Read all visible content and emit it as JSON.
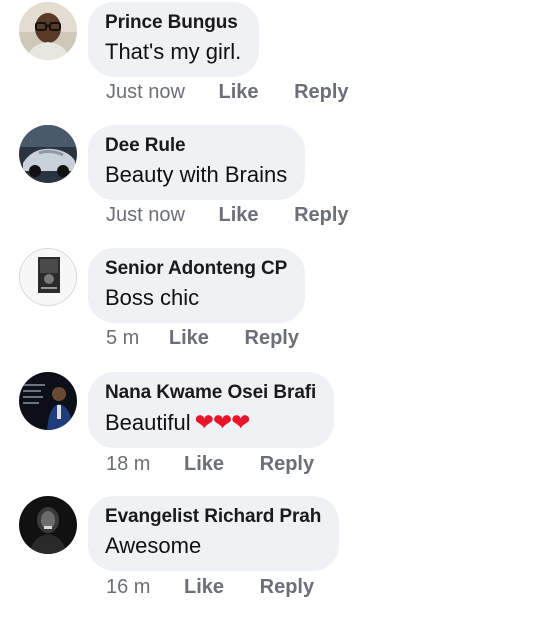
{
  "comments": [
    {
      "author": "Prince Bungus",
      "text": "That's my girl.",
      "time": "Just now",
      "like_label": "Like",
      "reply_label": "Reply",
      "avatar_icon": "man-glasses-avatar"
    },
    {
      "author": "Dee Rule",
      "text": "Beauty with Brains",
      "time": "Just now",
      "like_label": "Like",
      "reply_label": "Reply",
      "avatar_icon": "car-avatar"
    },
    {
      "author": "Senior Adonteng CP",
      "text": "Boss chic",
      "time": "5 m",
      "like_label": "Like",
      "reply_label": "Reply",
      "avatar_icon": "book-cover-avatar"
    },
    {
      "author": "Nana Kwame Osei Brafi",
      "text": "Beautiful",
      "emoji": "❤❤❤",
      "time": "18 m",
      "like_label": "Like",
      "reply_label": "Reply",
      "avatar_icon": "speaker-avatar"
    },
    {
      "author": "Evangelist Richard Prah",
      "text": "Awesome",
      "time": "16 m",
      "like_label": "Like",
      "reply_label": "Reply",
      "avatar_icon": "dark-portrait-avatar"
    }
  ],
  "colors": {
    "bubble": "#eff1f5",
    "meta_text": "#6b6f77",
    "heart": "#e8152a"
  }
}
